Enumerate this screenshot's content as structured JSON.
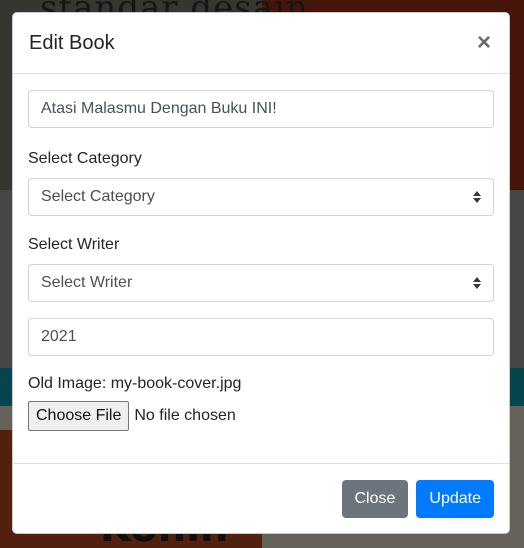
{
  "background": {
    "top_text": "standar desain",
    "bottom_text": "Kohin"
  },
  "modal": {
    "title": "Edit Book",
    "close_icon": "×"
  },
  "form": {
    "title_value": "Atasi Malasmu Dengan Buku INI!",
    "category_label": "Select Category",
    "category_selected": "Select Category",
    "writer_label": "Select Writer",
    "writer_selected": "Select Writer",
    "year_value": "2021",
    "old_image_text": "Old Image: my-book-cover.jpg",
    "file_button": "Choose File",
    "file_status": "No file chosen"
  },
  "footer": {
    "close_label": "Close",
    "update_label": "Update"
  },
  "colors": {
    "primary": "#007bff",
    "secondary": "#6c757d"
  },
  "icons": {
    "close": "close-icon",
    "select_caret": "select-caret-icon"
  }
}
